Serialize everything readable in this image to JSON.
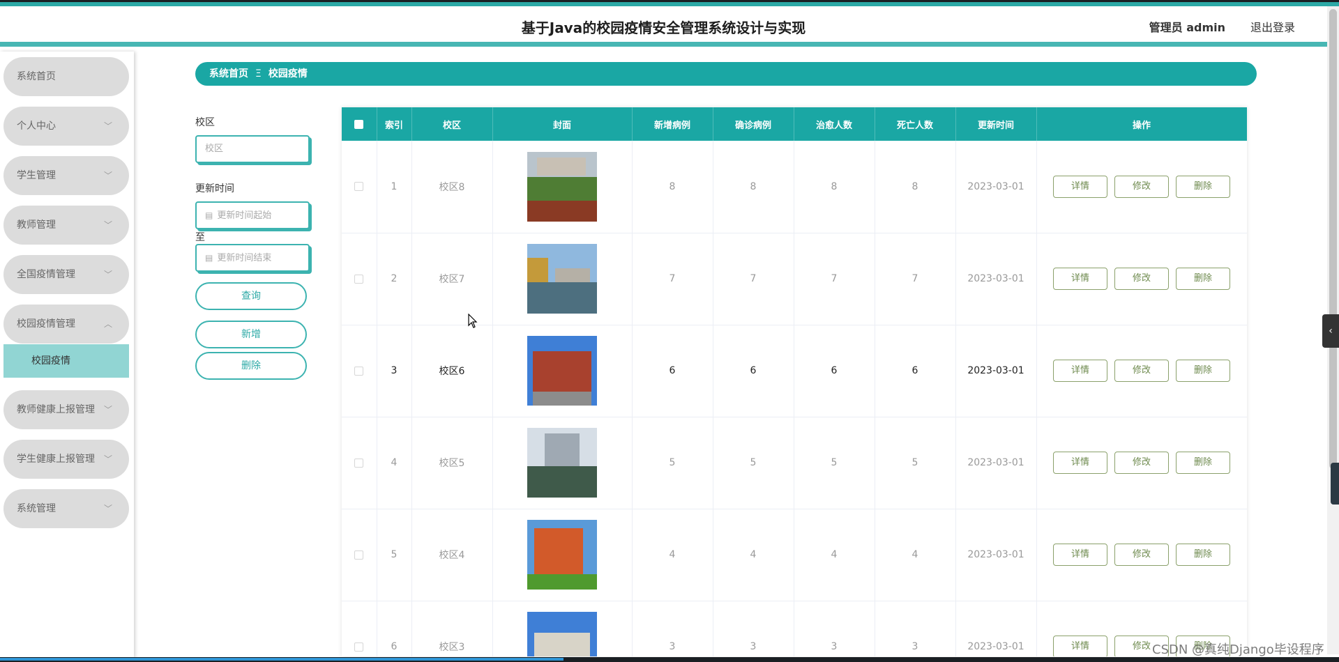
{
  "header": {
    "title": "基于Java的校园疫情安全管理系统设计与实现",
    "user": "管理员 admin",
    "logout": "退出登录"
  },
  "sidebar": {
    "items": [
      {
        "label": "系统首页"
      },
      {
        "label": "个人中心"
      },
      {
        "label": "学生管理"
      },
      {
        "label": "教师管理"
      },
      {
        "label": "全国疫情管理"
      },
      {
        "label": "校园疫情管理"
      },
      {
        "label": "教师健康上报管理"
      },
      {
        "label": "学生健康上报管理"
      },
      {
        "label": "系统管理"
      }
    ],
    "submenu": {
      "label": "校园疫情"
    },
    "chevron_down": "﹀",
    "chevron_up": "︿"
  },
  "breadcrumb": {
    "home": "系统首页",
    "separator": "Ξ",
    "current": "校园疫情"
  },
  "filters": {
    "campus_label": "校区",
    "campus_placeholder": "校区",
    "time_label": "更新时间",
    "time_start_placeholder": "更新时间起始",
    "to_label": "至",
    "time_end_placeholder": "更新时间结束",
    "query_button": "查询",
    "add_button": "新增",
    "delete_button": "删除"
  },
  "table": {
    "headers": [
      "索引",
      "校区",
      "封面",
      "新增病例",
      "确诊病例",
      "治愈人数",
      "死亡人数",
      "更新时间",
      "操作"
    ],
    "actions": {
      "detail": "详情",
      "edit": "修改",
      "delete": "删除"
    },
    "rows": [
      {
        "index": "1",
        "campus": "校区8",
        "new": "8",
        "confirmed": "8",
        "cured": "8",
        "deaths": "8",
        "time": "2023-03-01"
      },
      {
        "index": "2",
        "campus": "校区7",
        "new": "7",
        "confirmed": "7",
        "cured": "7",
        "deaths": "7",
        "time": "2023-03-01"
      },
      {
        "index": "3",
        "campus": "校区6",
        "new": "6",
        "confirmed": "6",
        "cured": "6",
        "deaths": "6",
        "time": "2023-03-01"
      },
      {
        "index": "4",
        "campus": "校区5",
        "new": "5",
        "confirmed": "5",
        "cured": "5",
        "deaths": "5",
        "time": "2023-03-01"
      },
      {
        "index": "5",
        "campus": "校区4",
        "new": "4",
        "confirmed": "4",
        "cured": "4",
        "deaths": "4",
        "time": "2023-03-01"
      },
      {
        "index": "6",
        "campus": "校区3",
        "new": "3",
        "confirmed": "3",
        "cured": "3",
        "deaths": "3",
        "time": "2023-03-01"
      }
    ]
  },
  "watermark": "CSDN @真纯Django毕设程序",
  "colors": {
    "primary": "#1aa7a4",
    "submenu": "#91d5d3",
    "action": "#6e8a4e"
  }
}
